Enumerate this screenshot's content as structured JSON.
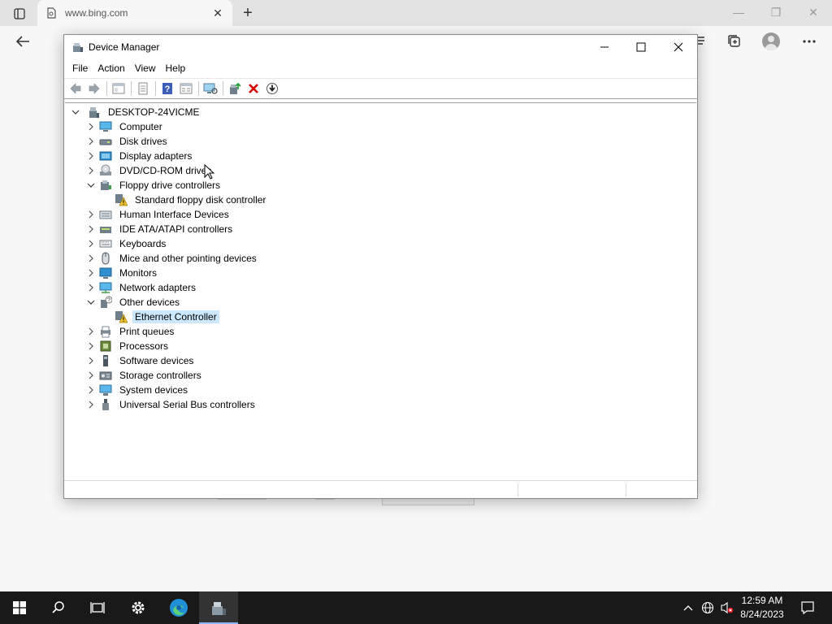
{
  "browser": {
    "tab_title": "www.bing.com",
    "new_tab_symbol": "+",
    "close_symbol": "✕",
    "minimize_symbol": "—",
    "restore_symbol": "❐"
  },
  "dialog": {
    "title": "Device Manager",
    "menu": [
      "File",
      "Action",
      "View",
      "Help"
    ],
    "toolbar_icons": [
      "back-icon",
      "forward-icon",
      "show-hide-tree-icon",
      "properties-icon",
      "help-icon",
      "view-icon",
      "scan-hardware-icon",
      "update-driver-icon",
      "uninstall-icon",
      "disable-device-icon"
    ],
    "computer_name": "DESKTOP-24VICME",
    "categories": [
      {
        "label": "Computer",
        "icon": "computer-icon",
        "expanded": false
      },
      {
        "label": "Disk drives",
        "icon": "disk-drive-icon",
        "expanded": false
      },
      {
        "label": "Display adapters",
        "icon": "display-adapter-icon",
        "expanded": false
      },
      {
        "label": "DVD/CD-ROM drives",
        "icon": "dvd-drive-icon",
        "expanded": false
      },
      {
        "label": "Floppy drive controllers",
        "icon": "floppy-controller-icon",
        "expanded": true,
        "children": [
          {
            "label": "Standard floppy disk controller",
            "icon": "warning-device-icon",
            "selected": false
          }
        ]
      },
      {
        "label": "Human Interface Devices",
        "icon": "hid-icon",
        "expanded": false
      },
      {
        "label": "IDE ATA/ATAPI controllers",
        "icon": "ide-controller-icon",
        "expanded": false
      },
      {
        "label": "Keyboards",
        "icon": "keyboard-icon",
        "expanded": false
      },
      {
        "label": "Mice and other pointing devices",
        "icon": "mouse-icon",
        "expanded": false
      },
      {
        "label": "Monitors",
        "icon": "monitor-icon",
        "expanded": false
      },
      {
        "label": "Network adapters",
        "icon": "network-adapter-icon",
        "expanded": false
      },
      {
        "label": "Other devices",
        "icon": "other-devices-icon",
        "expanded": true,
        "children": [
          {
            "label": "Ethernet Controller",
            "icon": "warning-device-icon",
            "selected": true
          }
        ]
      },
      {
        "label": "Print queues",
        "icon": "printer-icon",
        "expanded": false
      },
      {
        "label": "Processors",
        "icon": "processor-icon",
        "expanded": false
      },
      {
        "label": "Software devices",
        "icon": "software-device-icon",
        "expanded": false
      },
      {
        "label": "Storage controllers",
        "icon": "storage-controller-icon",
        "expanded": false
      },
      {
        "label": "System devices",
        "icon": "system-device-icon",
        "expanded": false
      },
      {
        "label": "Universal Serial Bus controllers",
        "icon": "usb-icon",
        "expanded": false
      }
    ]
  },
  "taskbar": {
    "time": "12:59 AM",
    "date": "8/24/2023",
    "apps": [
      "start-icon",
      "search-icon",
      "task-view-icon",
      "settings-icon",
      "edge-icon",
      "device-manager-icon"
    ]
  },
  "colors": {
    "selection": "#cce8ff",
    "taskbar": "#191919",
    "warning": "#f4c430",
    "uninstall_red": "#d40000"
  }
}
